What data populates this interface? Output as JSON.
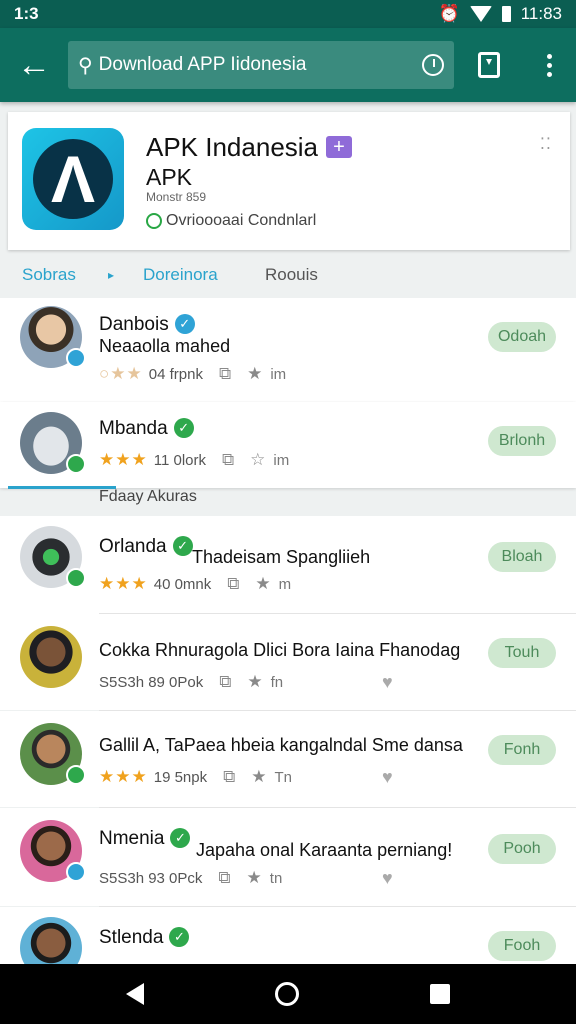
{
  "status_bar": {
    "left_text": "1:3",
    "time": "11:83"
  },
  "toolbar": {
    "search_text": "Download APP Iidonesia"
  },
  "app": {
    "title": "APK Indanesia",
    "subtitle": "APK",
    "version": "Monstr 859",
    "status": "Ovrioooaai Condnlarl"
  },
  "tabs": {
    "sources": "Sobras",
    "downloads": "Doreinora",
    "reviews": "Roouis"
  },
  "section_label": "Fdaay Akuras",
  "items": [
    {
      "name": "Danbois",
      "desc": "Neaaolla mahed",
      "meta": "04 frpnk",
      "meta_tail": "im",
      "action": "Odoah"
    },
    {
      "name": "Mbanda",
      "desc": "",
      "meta": "11 0lork",
      "meta_tail": "im",
      "action": "Brlonh"
    },
    {
      "name": "Orlanda",
      "desc": "Thadeisam Spangliieh",
      "meta": "40 0mnk",
      "meta_tail": "m",
      "action": "Bloah"
    },
    {
      "name": "Cokka Rhnuragola Dlici Bora Iaina Fhanodag",
      "desc": "",
      "meta": "S5S3h 89 0Pok",
      "meta_tail": "fn",
      "action": "Touh"
    },
    {
      "name": "Gallil A, TaPaea hbeia kangalndal Sme dansa",
      "desc": "",
      "meta": "19 5npk",
      "meta_tail": "Tn",
      "action": "Fonh"
    },
    {
      "name": "Nmenia",
      "desc": "Japaha onal Karaanta perniang!",
      "meta": "S5S3h 93 0Pck",
      "meta_tail": "tn",
      "action": "Pooh"
    },
    {
      "name": "Stlenda",
      "desc": "",
      "meta": "",
      "meta_tail": "",
      "action": "Fooh"
    }
  ]
}
